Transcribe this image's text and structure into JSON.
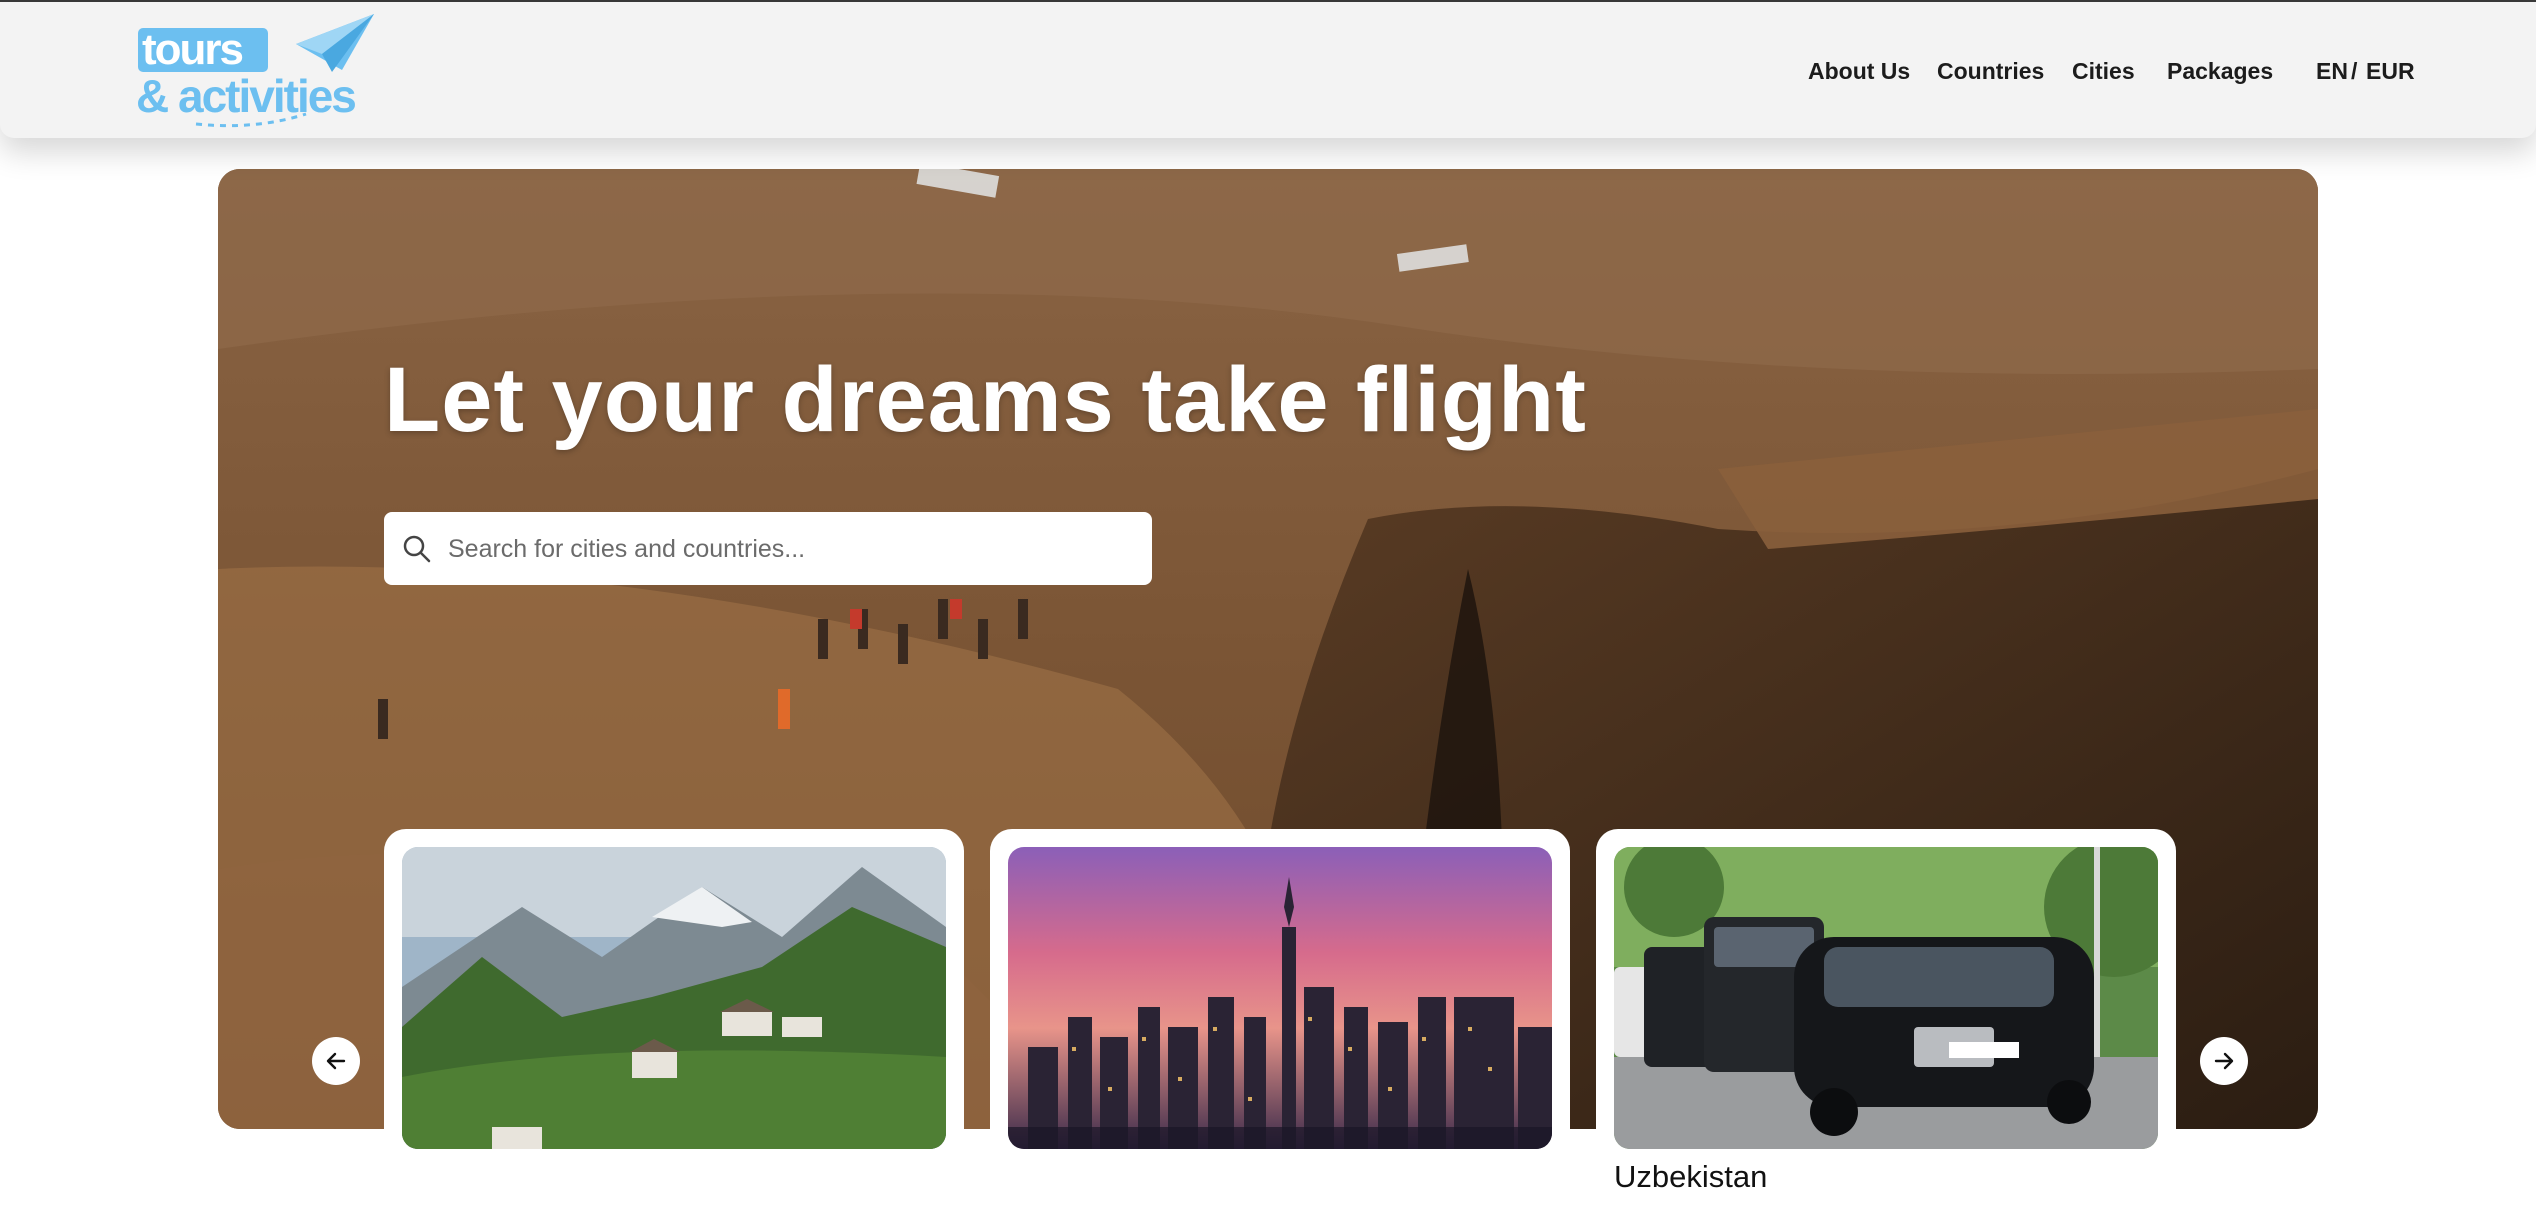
{
  "header": {
    "logo": {
      "line1": "tours",
      "line2": "& activities",
      "icon": "paper-plane-icon"
    },
    "nav": [
      "About Us",
      "Countries",
      "Cities",
      "Packages"
    ],
    "language": "EN",
    "separator": "/",
    "currency": "EUR"
  },
  "hero": {
    "headline": "Let your dreams take flight",
    "search": {
      "placeholder": "Search for cities and countries...",
      "value": "",
      "icon": "search-icon"
    },
    "prev_icon": "arrow-left-icon",
    "next_icon": "arrow-right-icon",
    "cards": [
      {
        "title": ""
      },
      {
        "title": ""
      },
      {
        "title": "Uzbekistan"
      }
    ]
  },
  "colors": {
    "logo_blue": "#6cbff0",
    "header_bg": "#f3f3f3",
    "text": "#1c1c1c"
  }
}
